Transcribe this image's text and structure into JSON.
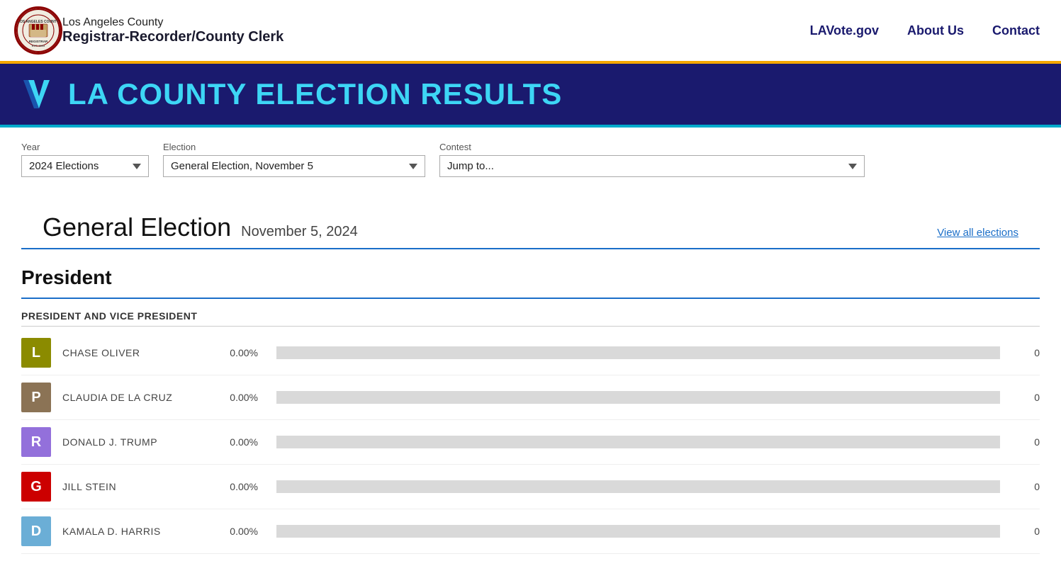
{
  "header": {
    "org_top": "Los Angeles County",
    "org_bottom": "Registrar-Recorder/County Clerk",
    "nav": [
      {
        "label": "LAVote.gov",
        "href": "#"
      },
      {
        "label": "About Us",
        "href": "#"
      },
      {
        "label": "Contact",
        "href": "#"
      }
    ]
  },
  "banner": {
    "title_plain": "LA COUNTY ",
    "title_highlight": "ELECTION RESULTS"
  },
  "filters": {
    "year_label": "Year",
    "election_label": "Election",
    "contest_label": "Contest",
    "year_value": "2024 Elections",
    "election_value": "General Election, November 5",
    "contest_placeholder": "Jump to..."
  },
  "election": {
    "title": "General Election",
    "date": "November 5, 2024",
    "view_all_label": "View all elections"
  },
  "contest_category": {
    "title": "President",
    "contest_name": "PRESIDENT AND VICE PRESIDENT",
    "candidates": [
      {
        "initial": "L",
        "color": "#8B8B00",
        "name": "CHASE OLIVER",
        "pct": "0.00%",
        "bar_pct": 0,
        "votes": "0"
      },
      {
        "initial": "P",
        "color": "#8B7355",
        "name": "CLAUDIA DE LA CRUZ",
        "pct": "0.00%",
        "bar_pct": 0,
        "votes": "0"
      },
      {
        "initial": "R",
        "color": "#9370DB",
        "name": "DONALD J. TRUMP",
        "pct": "0.00%",
        "bar_pct": 0,
        "votes": "0"
      },
      {
        "initial": "G",
        "color": "#CC0000",
        "name": "JILL STEIN",
        "pct": "0.00%",
        "bar_pct": 0,
        "votes": "0"
      },
      {
        "initial": "D",
        "color": "#6BAED6",
        "name": "KAMALA D. HARRIS",
        "pct": "0.00%",
        "bar_pct": 0,
        "votes": "0"
      }
    ]
  }
}
